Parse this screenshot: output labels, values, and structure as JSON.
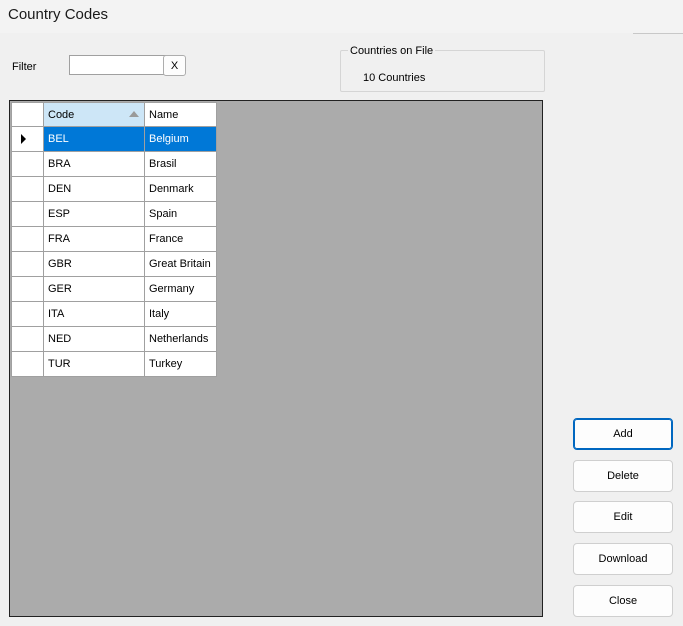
{
  "window": {
    "title": "Country Codes"
  },
  "filter": {
    "label": "Filter",
    "value": "",
    "placeholder": "",
    "clear_label": "X"
  },
  "summary": {
    "legend": "Countries on File",
    "count_text": "10 Countries"
  },
  "grid": {
    "columns": [
      "Code",
      "Name"
    ],
    "sorted_column": "Code",
    "selected_row": 0,
    "rows": [
      {
        "code": "BEL",
        "name": "Belgium"
      },
      {
        "code": "BRA",
        "name": "Brasil"
      },
      {
        "code": "DEN",
        "name": "Denmark"
      },
      {
        "code": "ESP",
        "name": "Spain"
      },
      {
        "code": "FRA",
        "name": "France"
      },
      {
        "code": "GBR",
        "name": "Great Britain"
      },
      {
        "code": "GER",
        "name": "Germany"
      },
      {
        "code": "ITA",
        "name": "Italy"
      },
      {
        "code": "NED",
        "name": "Netherlands"
      },
      {
        "code": "TUR",
        "name": "Turkey"
      }
    ]
  },
  "buttons": {
    "add": "Add",
    "delete": "Delete",
    "edit": "Edit",
    "download": "Download",
    "close": "Close"
  },
  "colors": {
    "selection": "#0078d7",
    "grid_background": "#ababab",
    "sorted_header": "#cde6f7",
    "default_button_border": "#0067c0"
  },
  "icons": {
    "row_indicator": "triangle-right-icon",
    "sort": "sort-ascending-icon"
  }
}
